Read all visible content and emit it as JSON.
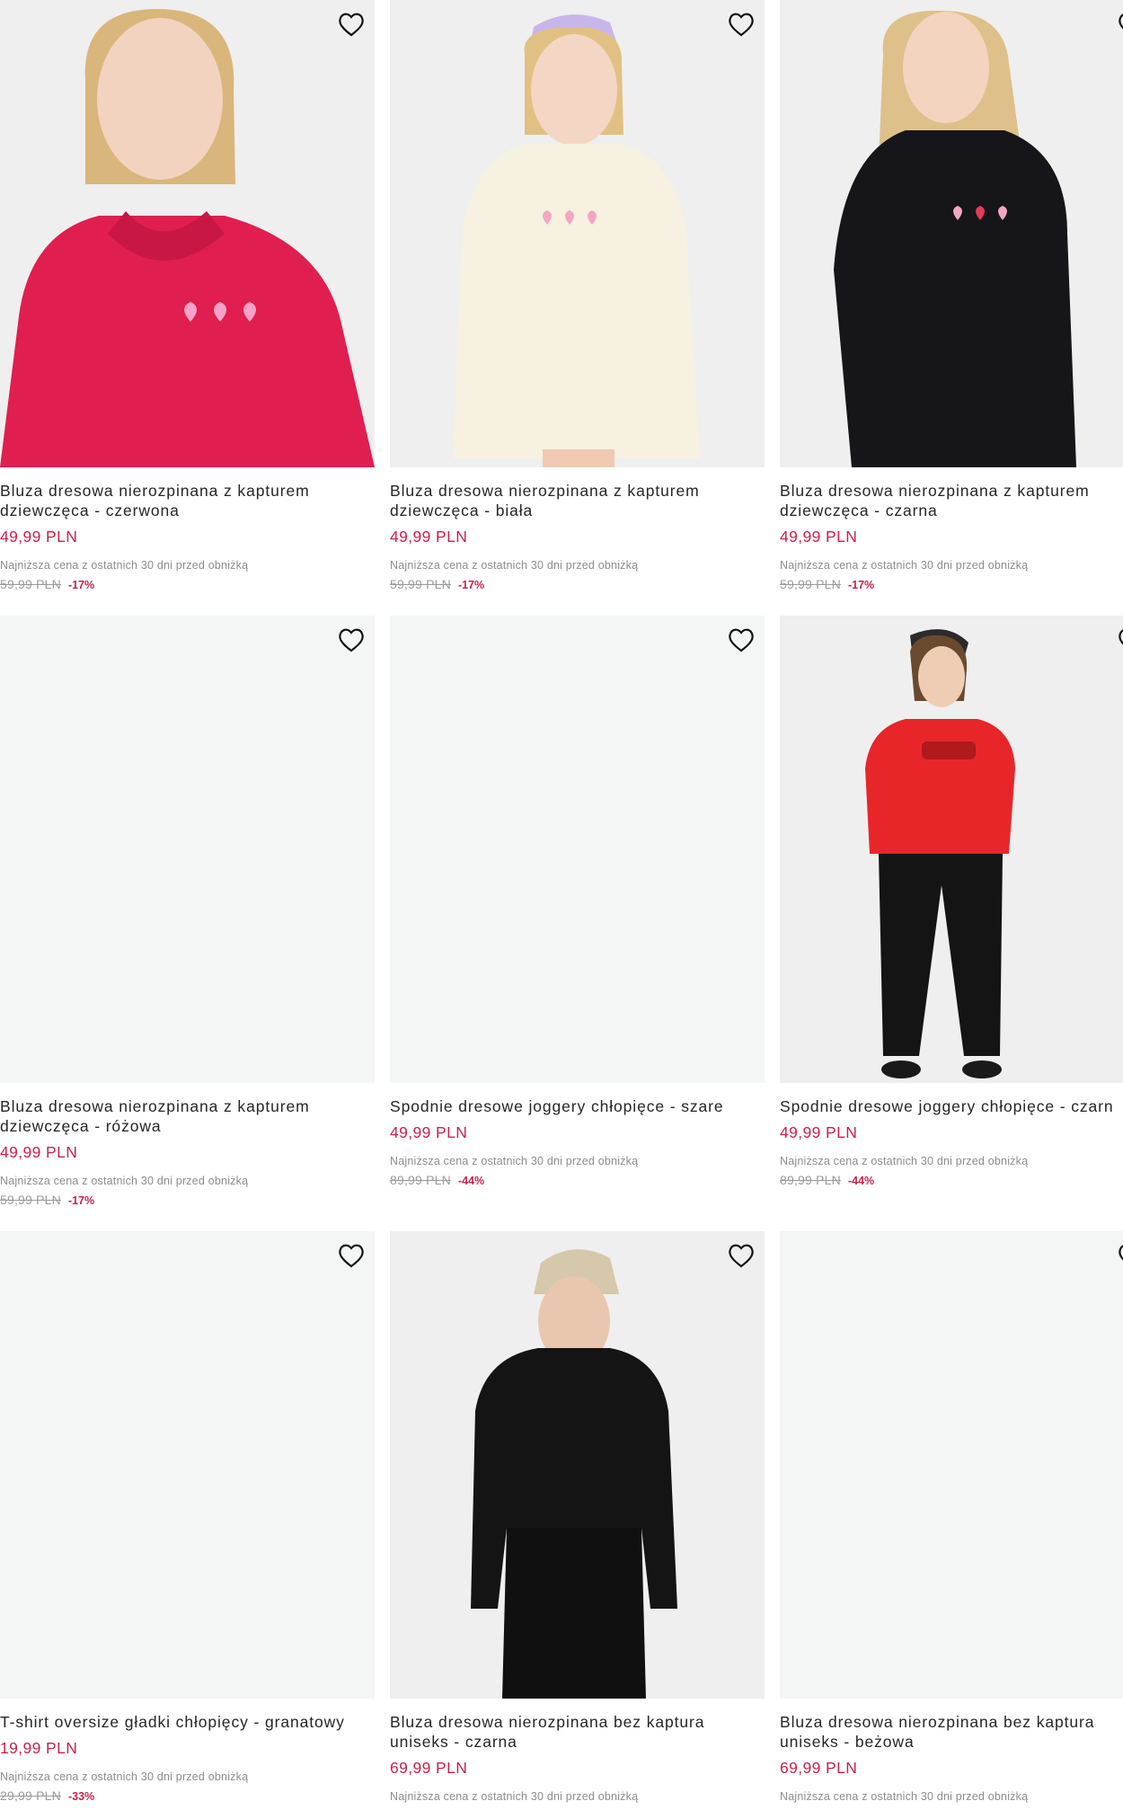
{
  "products": [
    {
      "title": "Bluza dresowa nierozpinana z kapturem dziewczęca - czerwona",
      "price": "49,99 PLN",
      "lowest_note": "Najniższa cena z ostatnich 30 dni przed obniżką",
      "old_price": "59,99 PLN",
      "discount": "-17%",
      "image": "girl-red-hoodie",
      "icon": "heart-outline-icon"
    },
    {
      "title": "Bluza dresowa nierozpinana z kapturem dziewczęca - biała",
      "price": "49,99 PLN",
      "lowest_note": "Najniższa cena z ostatnich 30 dni przed obniżką",
      "old_price": "59,99 PLN",
      "discount": "-17%",
      "image": "girl-white-hoodie-cap",
      "icon": "heart-outline-icon"
    },
    {
      "title": "Bluza dresowa nierozpinana z kapturem dziewczęca - czarna",
      "price": "49,99 PLN",
      "lowest_note": "Najniższa cena z ostatnich 30 dni przed obniżką",
      "old_price": "59,99 PLN",
      "discount": "-17%",
      "image": "girl-black-hoodie",
      "icon": "heart-outline-icon"
    },
    {
      "title": "Bluza dresowa nierozpinana z kapturem dziewczęca - różowa",
      "price": "49,99 PLN",
      "lowest_note": "Najniższa cena z ostatnich 30 dni przed obniżką",
      "old_price": "59,99 PLN",
      "discount": "-17%",
      "image": "empty",
      "icon": "heart-outline-icon"
    },
    {
      "title": "Spodnie dresowe joggery chłopięce - szare",
      "price": "49,99 PLN",
      "lowest_note": "Najniższa cena z ostatnich 30 dni przed obniżką",
      "old_price": "89,99 PLN",
      "discount": "-44%",
      "image": "empty",
      "icon": "heart-outline-icon"
    },
    {
      "title": "Spodnie dresowe joggery chłopięce - czarn",
      "price": "49,99 PLN",
      "lowest_note": "Najniższa cena z ostatnich 30 dni przed obniżką",
      "old_price": "89,99 PLN",
      "discount": "-44%",
      "image": "boy-red-sweatshirt",
      "icon": "heart-outline-icon"
    },
    {
      "title": "T-shirt oversize gładki chłopięcy - granatowy",
      "price": "19,99 PLN",
      "lowest_note": "Najniższa cena z ostatnich 30 dni przed obniżką",
      "old_price": "29,99 PLN",
      "discount": "-33%",
      "image": "empty",
      "icon": "heart-outline-icon"
    },
    {
      "title": "Bluza dresowa nierozpinana bez kaptura uniseks - czarna",
      "price": "69,99 PLN",
      "lowest_note": "Najniższa cena z ostatnich 30 dni przed obniżką",
      "old_price": "",
      "discount": "",
      "image": "man-black-sweatshirt",
      "icon": "heart-outline-icon"
    },
    {
      "title": "Bluza dresowa nierozpinana bez kaptura uniseks - beżowa",
      "price": "69,99 PLN",
      "lowest_note": "Najniższa cena z ostatnich 30 dni przed obniżką",
      "old_price": "",
      "discount": "",
      "image": "empty",
      "icon": "heart-outline-icon"
    }
  ],
  "colors": {
    "price": "#c8224e",
    "discount": "#c8224e",
    "muted": "#8d8d8d",
    "image_bg": "#f0f1f1"
  }
}
